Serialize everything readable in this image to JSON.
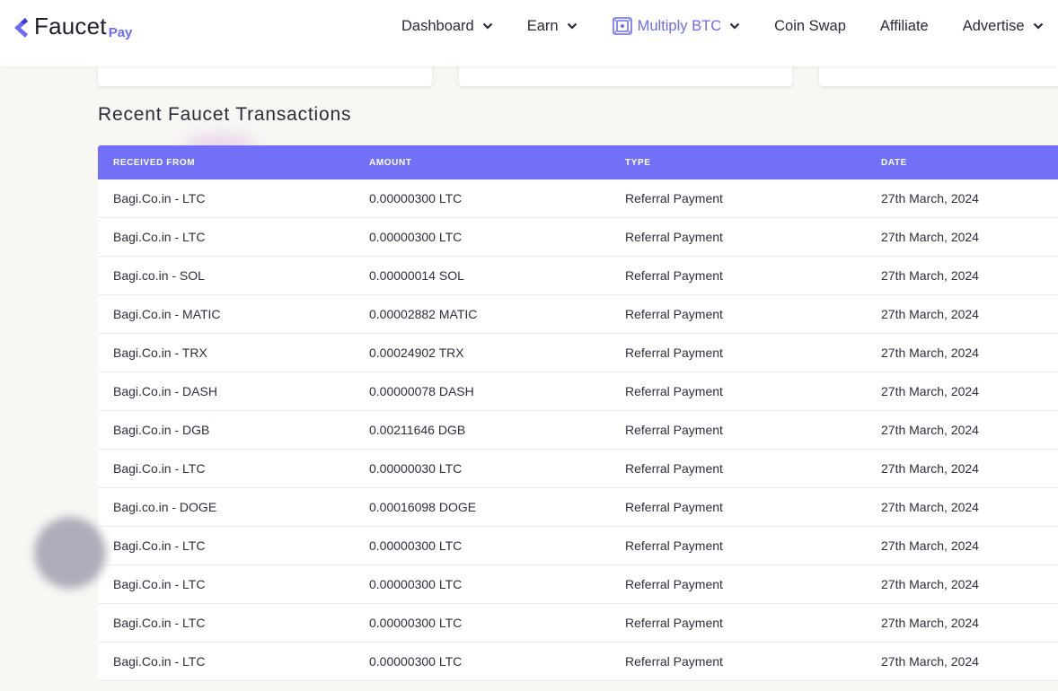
{
  "brand": {
    "logo_main": "Faucet",
    "logo_sub": "Pay",
    "accent_color": "#6c6cf5",
    "header_bg": "#7270f7"
  },
  "nav": {
    "items": [
      {
        "label": "Dashboard",
        "dropdown": true
      },
      {
        "label": "Earn",
        "dropdown": true
      },
      {
        "label": "Multiply BTC",
        "dropdown": true,
        "active": true,
        "icon": "dice-icon"
      },
      {
        "label": "Coin Swap",
        "dropdown": false
      },
      {
        "label": "Affiliate",
        "dropdown": false
      },
      {
        "label": "Advertise",
        "dropdown": true
      }
    ]
  },
  "section": {
    "title": "Recent Faucet Transactions"
  },
  "table": {
    "columns": [
      "RECEIVED FROM",
      "AMOUNT",
      "TYPE",
      "DATE"
    ],
    "rows": [
      [
        "Bagi.Co.in - LTC",
        "0.00000300 LTC",
        "Referral Payment",
        "27th March, 2024"
      ],
      [
        "Bagi.Co.in - LTC",
        "0.00000300 LTC",
        "Referral Payment",
        "27th March, 2024"
      ],
      [
        "Bagi.co.in - SOL",
        "0.00000014 SOL",
        "Referral Payment",
        "27th March, 2024"
      ],
      [
        "Bagi.Co.in - MATIC",
        "0.00002882 MATIC",
        "Referral Payment",
        "27th March, 2024"
      ],
      [
        "Bagi.Co.in - TRX",
        "0.00024902 TRX",
        "Referral Payment",
        "27th March, 2024"
      ],
      [
        "Bagi.Co.in - DASH",
        "0.00000078 DASH",
        "Referral Payment",
        "27th March, 2024"
      ],
      [
        "Bagi.Co.in - DGB",
        "0.00211646 DGB",
        "Referral Payment",
        "27th March, 2024"
      ],
      [
        "Bagi.Co.in - LTC",
        "0.00000030 LTC",
        "Referral Payment",
        "27th March, 2024"
      ],
      [
        "Bagi.co.in - DOGE",
        "0.00016098 DOGE",
        "Referral Payment",
        "27th March, 2024"
      ],
      [
        "Bagi.Co.in - LTC",
        "0.00000300 LTC",
        "Referral Payment",
        "27th March, 2024"
      ],
      [
        "Bagi.Co.in - LTC",
        "0.00000300 LTC",
        "Referral Payment",
        "27th March, 2024"
      ],
      [
        "Bagi.Co.in - LTC",
        "0.00000300 LTC",
        "Referral Payment",
        "27th March, 2024"
      ],
      [
        "Bagi.Co.in - LTC",
        "0.00000300 LTC",
        "Referral Payment",
        "27th March, 2024"
      ]
    ]
  }
}
